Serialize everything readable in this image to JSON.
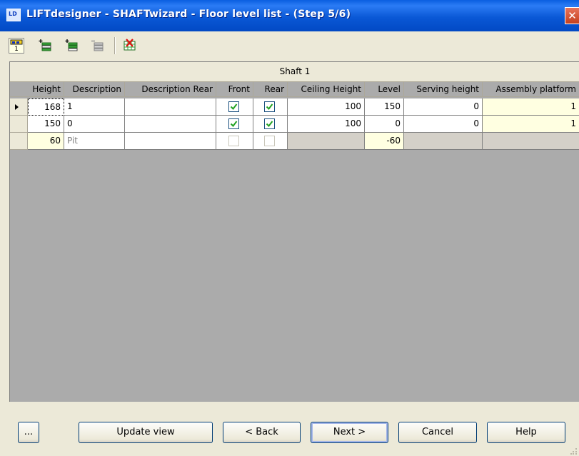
{
  "window": {
    "title": "LIFTdesigner - SHAFTwizard - Floor level list - (Step 5/6)",
    "icon_text": "LD",
    "close_glyph": "✕"
  },
  "toolbar": {
    "items": [
      {
        "icon": "floor-level-icon",
        "label": "1"
      },
      {
        "icon": "insert-row-above-icon"
      },
      {
        "icon": "insert-row-below-icon"
      },
      {
        "icon": "remove-row-icon"
      },
      {
        "icon": "delete-grid-icon"
      }
    ]
  },
  "grid": {
    "band_title": "Shaft 1",
    "columns": [
      "Height",
      "Description",
      "Description Rear",
      "Front",
      "Rear",
      "Ceiling Height",
      "Level",
      "Serving height",
      "Assembly platform"
    ],
    "rows": [
      {
        "height": "168",
        "description": "1",
        "description_rear": "",
        "front": true,
        "rear": true,
        "ceiling_height": "100",
        "level": "150",
        "serving_height": "0",
        "assembly_platform": "1",
        "selected": true
      },
      {
        "height": "150",
        "description": "0",
        "description_rear": "",
        "front": true,
        "rear": true,
        "ceiling_height": "100",
        "level": "0",
        "serving_height": "0",
        "assembly_platform": "1"
      },
      {
        "height": "60",
        "description": "Pit",
        "description_rear": "",
        "front": false,
        "rear": false,
        "ceiling_height": "",
        "level": "-60",
        "serving_height": "",
        "assembly_platform": ""
      }
    ]
  },
  "buttons": {
    "more": "...",
    "update_view": "Update view",
    "back": "< Back",
    "next": "Next >",
    "cancel": "Cancel",
    "help": "Help"
  },
  "colors": {
    "titlebar": "#0a58d6",
    "window_bg": "#ece9d8",
    "yellow_cell": "#ffffe1",
    "check": "#21a121"
  }
}
